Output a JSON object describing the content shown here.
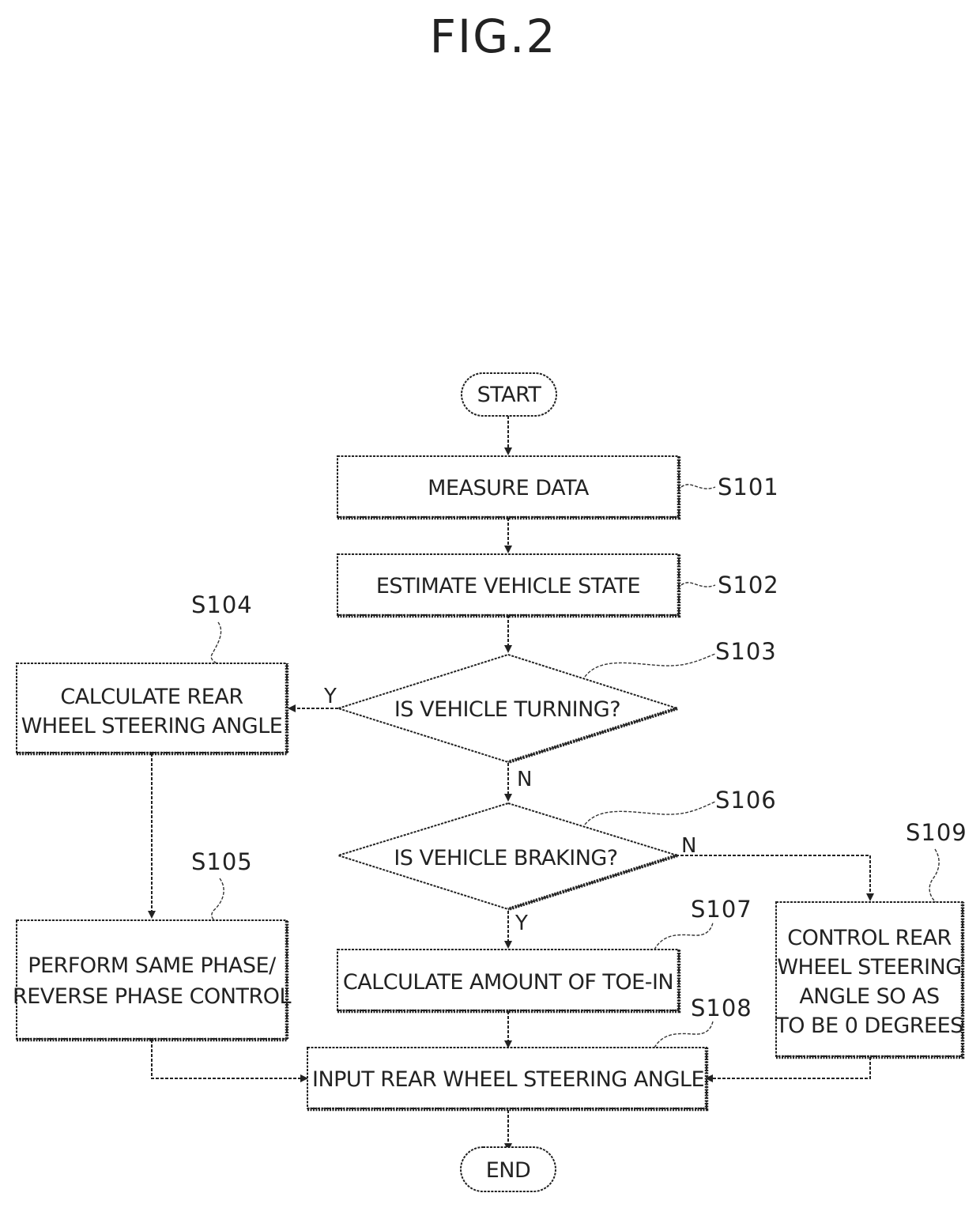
{
  "figure": {
    "title": "FIG.2"
  },
  "terminals": {
    "start": "START",
    "end": "END"
  },
  "steps": {
    "s101": {
      "id": "S101",
      "lines": [
        "MEASURE DATA"
      ]
    },
    "s102": {
      "id": "S102",
      "lines": [
        "ESTIMATE VEHICLE STATE"
      ]
    },
    "s103": {
      "id": "S103",
      "lines": [
        "IS VEHICLE TURNING?"
      ]
    },
    "s104": {
      "id": "S104",
      "lines": [
        "CALCULATE REAR",
        "WHEEL STEERING ANGLE"
      ]
    },
    "s105": {
      "id": "S105",
      "lines": [
        "PERFORM SAME PHASE/",
        "REVERSE PHASE CONTROL"
      ]
    },
    "s106": {
      "id": "S106",
      "lines": [
        "IS VEHICLE BRAKING?"
      ]
    },
    "s107": {
      "id": "S107",
      "lines": [
        "CALCULATE AMOUNT OF TOE-IN"
      ]
    },
    "s108": {
      "id": "S108",
      "lines": [
        "INPUT REAR WHEEL STEERING ANGLE"
      ]
    },
    "s109": {
      "id": "S109",
      "lines": [
        "CONTROL REAR",
        "WHEEL STEERING",
        "ANGLE SO AS",
        "TO BE 0 DEGREES"
      ]
    }
  },
  "branch_labels": {
    "s103_yes": "Y",
    "s103_no": "N",
    "s106_yes": "Y",
    "s106_no": "N"
  }
}
